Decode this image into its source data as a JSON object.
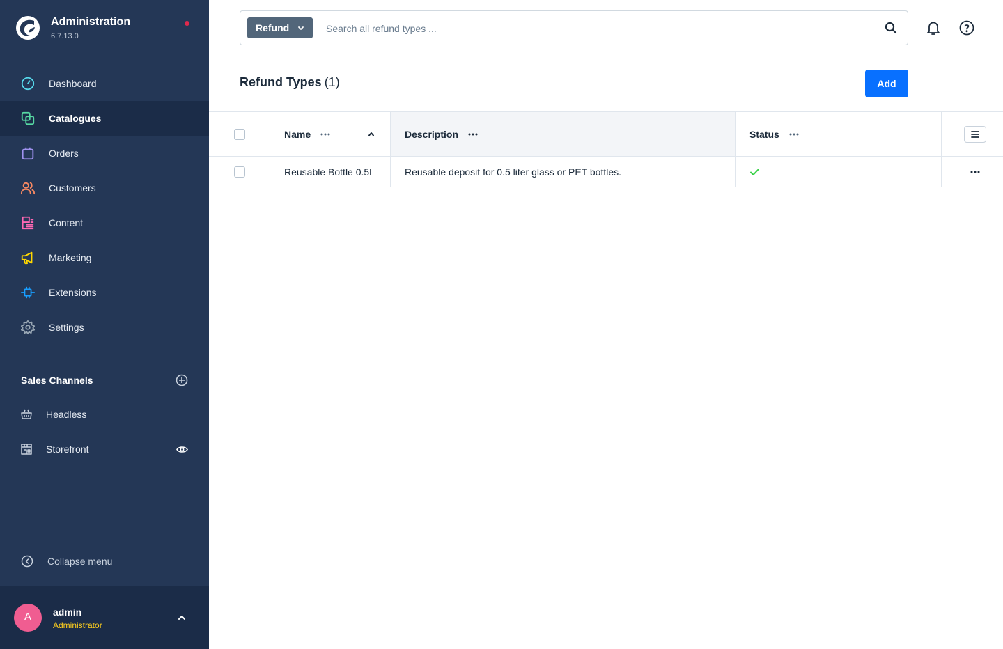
{
  "sidebar": {
    "brand_title": "Administration",
    "brand_version": "6.7.13.0",
    "nav": [
      {
        "label": "Dashboard",
        "icon": "gauge-icon",
        "color": "#57d9ec",
        "active": false
      },
      {
        "label": "Catalogues",
        "icon": "catalogue-icon",
        "color": "#57d9a3",
        "active": true
      },
      {
        "label": "Orders",
        "icon": "shopping-bag-icon",
        "color": "#a092f0",
        "active": false
      },
      {
        "label": "Customers",
        "icon": "users-icon",
        "color": "#f88962",
        "active": false
      },
      {
        "label": "Content",
        "icon": "content-icon",
        "color": "#ff68b4",
        "active": false
      },
      {
        "label": "Marketing",
        "icon": "megaphone-icon",
        "color": "#ffd700",
        "active": false
      },
      {
        "label": "Extensions",
        "icon": "plug-icon",
        "color": "#189eff",
        "active": false
      },
      {
        "label": "Settings",
        "icon": "gear-icon",
        "color": "#9aa8b5",
        "active": false
      }
    ],
    "sales_channels_title": "Sales Channels",
    "sales_channels": [
      {
        "label": "Headless",
        "icon": "basket-icon"
      },
      {
        "label": "Storefront",
        "icon": "storefront-icon"
      }
    ],
    "collapse_label": "Collapse menu",
    "user": {
      "initial": "A",
      "name": "admin",
      "role": "Administrator"
    }
  },
  "topbar": {
    "search_type": "Refund",
    "search_placeholder": "Search all refund types ..."
  },
  "page": {
    "title": "Refund Types",
    "count": "(1)",
    "add_label": "Add"
  },
  "table": {
    "columns": {
      "name": "Name",
      "description": "Description",
      "status": "Status"
    },
    "rows": [
      {
        "name": "Reusable Bottle 0.5l",
        "description": "Reusable deposit for 0.5 liter glass or PET bottles.",
        "status": "active"
      }
    ]
  },
  "colors": {
    "sidebar_bg": "#243756",
    "primary": "#0870ff",
    "success": "#37d046"
  }
}
